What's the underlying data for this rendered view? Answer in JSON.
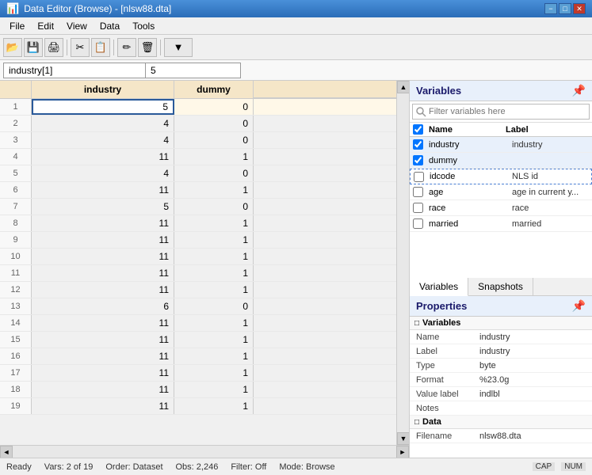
{
  "titleBar": {
    "title": "Data Editor (Browse) - [nlsw88.dta]",
    "controls": [
      "−",
      "□",
      "✕"
    ]
  },
  "menuBar": {
    "items": [
      "File",
      "Edit",
      "View",
      "Data",
      "Tools"
    ]
  },
  "toolbar": {
    "buttons": [
      "📂",
      "💾",
      "🖨",
      "✂",
      "📋",
      "✏",
      "🗑",
      "▼"
    ]
  },
  "addressBar": {
    "label": "industry[1]",
    "value": "5"
  },
  "grid": {
    "columns": [
      "industry",
      "dummy"
    ],
    "rows": [
      {
        "num": 1,
        "industry": 5,
        "dummy": 0,
        "selected": true
      },
      {
        "num": 2,
        "industry": 4,
        "dummy": 0
      },
      {
        "num": 3,
        "industry": 4,
        "dummy": 0
      },
      {
        "num": 4,
        "industry": 11,
        "dummy": 1
      },
      {
        "num": 5,
        "industry": 4,
        "dummy": 0
      },
      {
        "num": 6,
        "industry": 11,
        "dummy": 1
      },
      {
        "num": 7,
        "industry": 5,
        "dummy": 0
      },
      {
        "num": 8,
        "industry": 11,
        "dummy": 1
      },
      {
        "num": 9,
        "industry": 11,
        "dummy": 1
      },
      {
        "num": 10,
        "industry": 11,
        "dummy": 1
      },
      {
        "num": 11,
        "industry": 11,
        "dummy": 1
      },
      {
        "num": 12,
        "industry": 11,
        "dummy": 1
      },
      {
        "num": 13,
        "industry": 6,
        "dummy": 0
      },
      {
        "num": 14,
        "industry": 11,
        "dummy": 1
      },
      {
        "num": 15,
        "industry": 11,
        "dummy": 1
      },
      {
        "num": 16,
        "industry": 11,
        "dummy": 1
      },
      {
        "num": 17,
        "industry": 11,
        "dummy": 1
      },
      {
        "num": 18,
        "industry": 11,
        "dummy": 1
      },
      {
        "num": 19,
        "industry": 11,
        "dummy": 1
      }
    ]
  },
  "variablesPanel": {
    "title": "Variables",
    "searchPlaceholder": "Filter variables here",
    "columns": [
      "Name",
      "Label"
    ],
    "variables": [
      {
        "checked": true,
        "name": "industry",
        "label": "industry",
        "dotted": false
      },
      {
        "checked": true,
        "name": "dummy",
        "label": "",
        "dotted": false
      },
      {
        "checked": false,
        "name": "idcode",
        "label": "NLS id",
        "dotted": true
      },
      {
        "checked": false,
        "name": "age",
        "label": "age in current y...",
        "dotted": false
      },
      {
        "checked": false,
        "name": "race",
        "label": "race",
        "dotted": false
      },
      {
        "checked": false,
        "name": "married",
        "label": "married",
        "dotted": false
      }
    ]
  },
  "tabs": {
    "items": [
      "Variables",
      "Snapshots"
    ],
    "active": "Variables"
  },
  "propertiesPanel": {
    "title": "Properties",
    "sections": [
      {
        "name": "Variables",
        "expanded": true,
        "rows": [
          {
            "key": "Name",
            "value": "industry"
          },
          {
            "key": "Label",
            "value": "industry"
          },
          {
            "key": "Type",
            "value": "byte"
          },
          {
            "key": "Format",
            "value": "%23.0g"
          },
          {
            "key": "Value label",
            "value": "indlbl"
          },
          {
            "key": "Notes",
            "value": ""
          }
        ]
      },
      {
        "name": "Data",
        "expanded": true,
        "rows": [
          {
            "key": "Filename",
            "value": "nlsw88.dta"
          }
        ]
      }
    ]
  },
  "statusBar": {
    "ready": "Ready",
    "vars": "Vars: 2 of 19",
    "order": "Order: Dataset",
    "obs": "Obs: 2,246",
    "filter": "Filter: Off",
    "mode": "Mode: Browse",
    "cap": "CAP",
    "num": "NUM"
  }
}
